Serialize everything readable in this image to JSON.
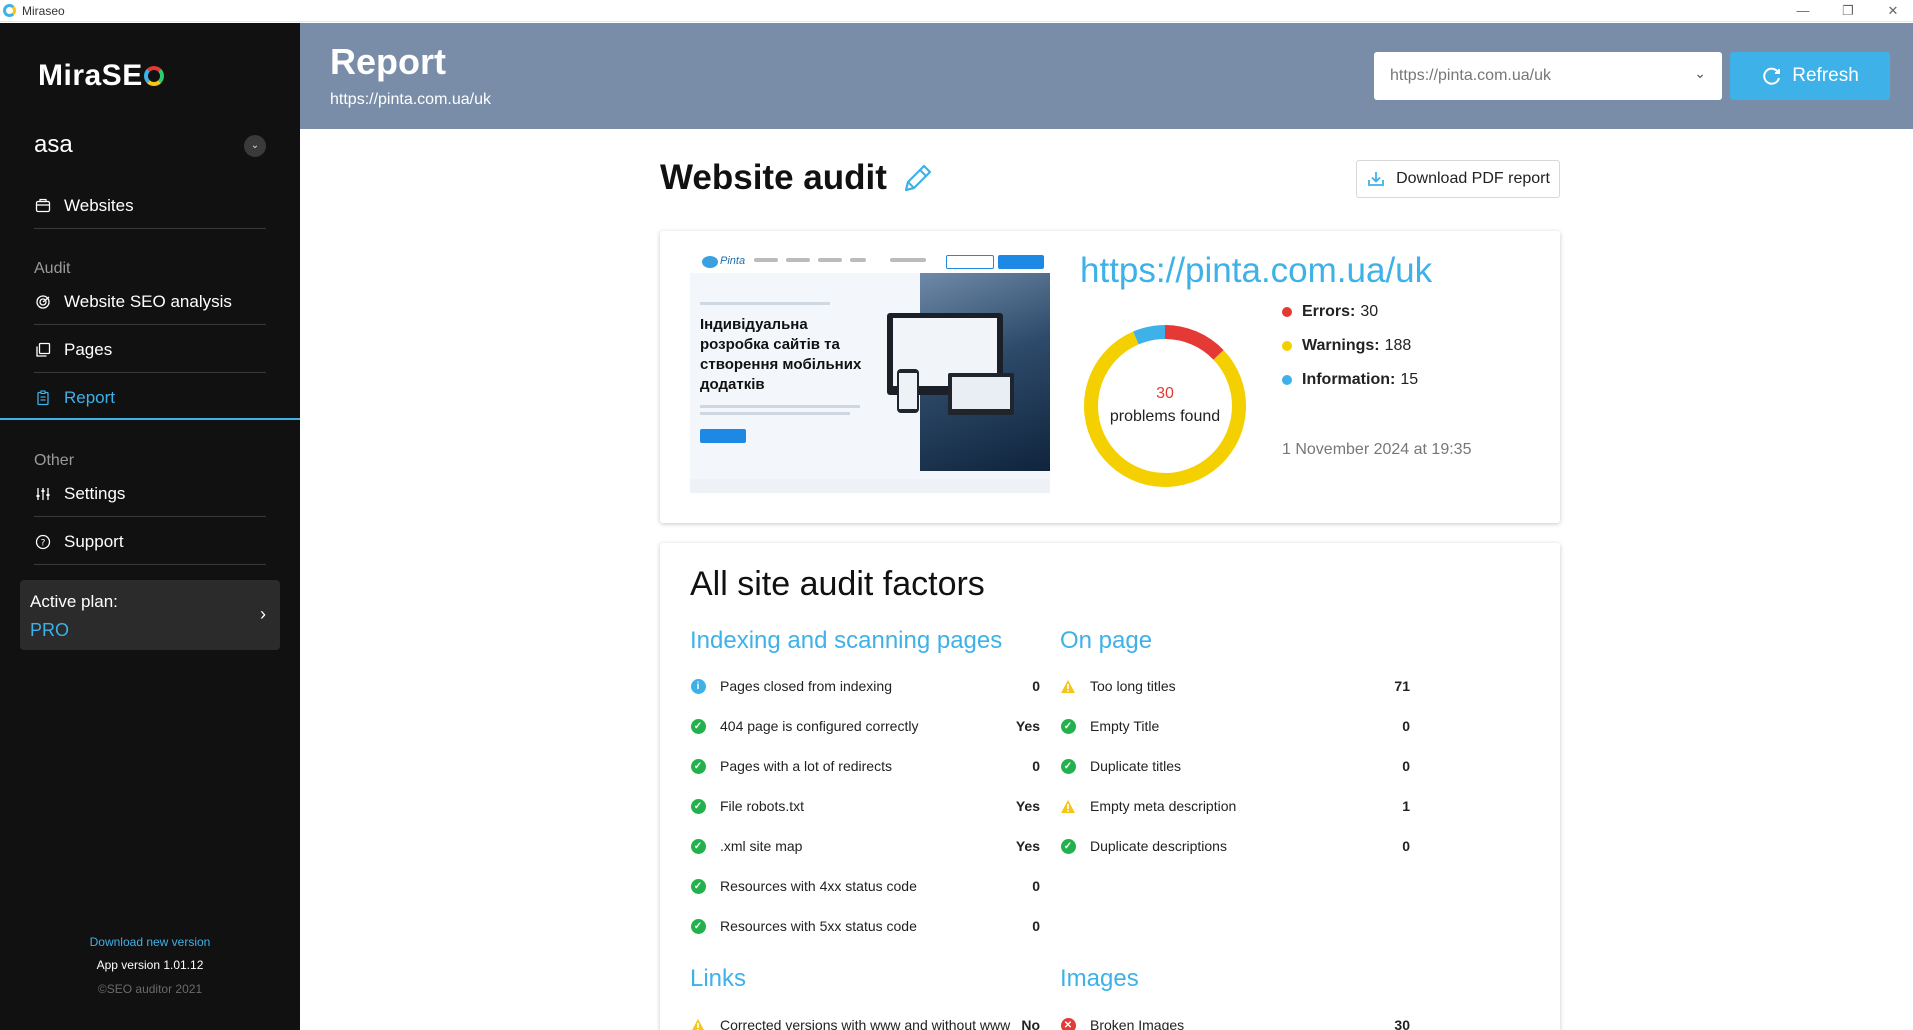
{
  "window": {
    "title": "Miraseo",
    "controls": {
      "minimize": "—",
      "restore": "❐",
      "close": "✕"
    }
  },
  "sidebar": {
    "brand": "MiraSE",
    "project": {
      "name": "asa",
      "chevron_icon": "chevron-down-icon"
    },
    "items": [
      {
        "label": "Websites",
        "icon": "websites-icon"
      }
    ],
    "audit_section": "Audit",
    "audit_items": [
      {
        "label": "Website SEO analysis",
        "icon": "seo-analysis-icon"
      },
      {
        "label": "Pages",
        "icon": "pages-icon"
      },
      {
        "label": "Report",
        "icon": "report-icon",
        "active": true
      }
    ],
    "other_section": "Other",
    "other_items": [
      {
        "label": "Settings",
        "icon": "settings-icon"
      },
      {
        "label": "Support",
        "icon": "support-icon"
      }
    ],
    "plan": {
      "label": "Active plan:",
      "value": "PRO"
    },
    "footer": {
      "download": "Download new version",
      "version": "App version 1.01.12",
      "copyright": "©SEO auditor 2021"
    }
  },
  "header": {
    "title": "Report",
    "url": "https://pinta.com.ua/uk",
    "site_select": {
      "value": "https://pinta.com.ua/uk"
    },
    "refresh_label": "Refresh"
  },
  "main": {
    "title": "Website audit",
    "pdf_label": "Download PDF report",
    "summary": {
      "site_url": "https://pinta.com.ua/uk",
      "preview": {
        "logo_text": "Pinta",
        "headline": "Індивідуальна розробка сайтів та створення мобільних додатків"
      },
      "problems_count": "30",
      "problems_label": "problems found",
      "errors": {
        "label": "Errors:",
        "value": "30",
        "color": "#e53935"
      },
      "warnings": {
        "label": "Warnings:",
        "value": "188",
        "color": "#f5d000"
      },
      "information": {
        "label": "Information:",
        "value": "15",
        "color": "#3db1e8"
      },
      "date": "1 November 2024 at 19:35",
      "chart_levels": {
        "errors": 30,
        "warnings": 188,
        "information": 15
      }
    },
    "factors": {
      "title": "All site audit factors",
      "indexing": {
        "title": "Indexing and scanning pages",
        "rows": [
          {
            "label": "Pages closed from indexing",
            "value": "0",
            "status": "info"
          },
          {
            "label": "404 page is configured correctly",
            "value": "Yes",
            "status": "ok"
          },
          {
            "label": "Pages with a lot of redirects",
            "value": "0",
            "status": "ok"
          },
          {
            "label": "File robots.txt",
            "value": "Yes",
            "status": "ok"
          },
          {
            "label": ".xml site map",
            "value": "Yes",
            "status": "ok"
          },
          {
            "label": "Resources with 4xx status code",
            "value": "0",
            "status": "ok"
          },
          {
            "label": "Resources with 5xx status code",
            "value": "0",
            "status": "ok"
          }
        ]
      },
      "on_page": {
        "title": "On page",
        "rows": [
          {
            "label": "Too long titles",
            "value": "71",
            "status": "warning"
          },
          {
            "label": "Empty Title",
            "value": "0",
            "status": "ok"
          },
          {
            "label": "Duplicate titles",
            "value": "0",
            "status": "ok"
          },
          {
            "label": "Empty meta description",
            "value": "1",
            "status": "warning"
          },
          {
            "label": "Duplicate descriptions",
            "value": "0",
            "status": "ok"
          }
        ]
      },
      "links": {
        "title": "Links",
        "rows": [
          {
            "label": "Corrected versions with www and without www",
            "value": "No",
            "status": "warning"
          }
        ]
      },
      "images": {
        "title": "Images",
        "rows": [
          {
            "label": "Broken Images",
            "value": "30",
            "status": "error"
          }
        ]
      }
    }
  },
  "colors": {
    "accent": "#3db1e8",
    "header_bg": "#7a8da8",
    "sidebar_bg": "#111111"
  }
}
